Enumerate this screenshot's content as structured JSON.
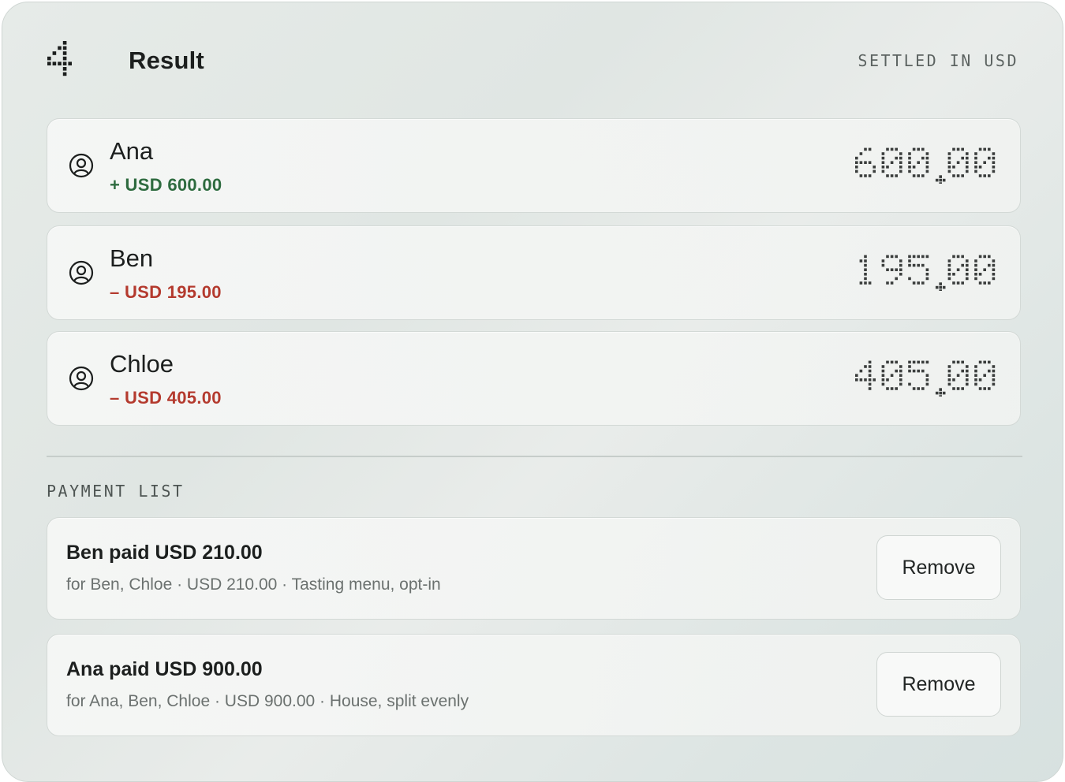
{
  "header": {
    "step_icon": "digit-four-dot-icon",
    "title": "Result",
    "settled_label": "SETTLED IN USD"
  },
  "balances": [
    {
      "name": "Ana",
      "delta": "+ USD 600.00",
      "amount": "600.00",
      "direction": "positive",
      "icon": "user-circle-icon"
    },
    {
      "name": "Ben",
      "delta": "– USD 195.00",
      "amount": "195.00",
      "direction": "negative",
      "icon": "user-circle-icon"
    },
    {
      "name": "Chloe",
      "delta": "– USD 405.00",
      "amount": "405.00",
      "direction": "negative",
      "icon": "user-circle-icon"
    }
  ],
  "payment_section": {
    "label": "PAYMENT LIST"
  },
  "payments": [
    {
      "title": "Ben paid USD 210.00",
      "detail": "for Ben, Chloe · USD 210.00 · Tasting menu, opt-in",
      "remove_label": "Remove"
    },
    {
      "title": "Ana paid USD 900.00",
      "detail": "for Ana, Ben, Chloe · USD 900.00 · House, split evenly",
      "remove_label": "Remove"
    }
  ],
  "colors": {
    "positive": "#2e6b3f",
    "negative": "#b43a2e",
    "text": "#1c1f1e",
    "dot": "#3a3d3c"
  }
}
